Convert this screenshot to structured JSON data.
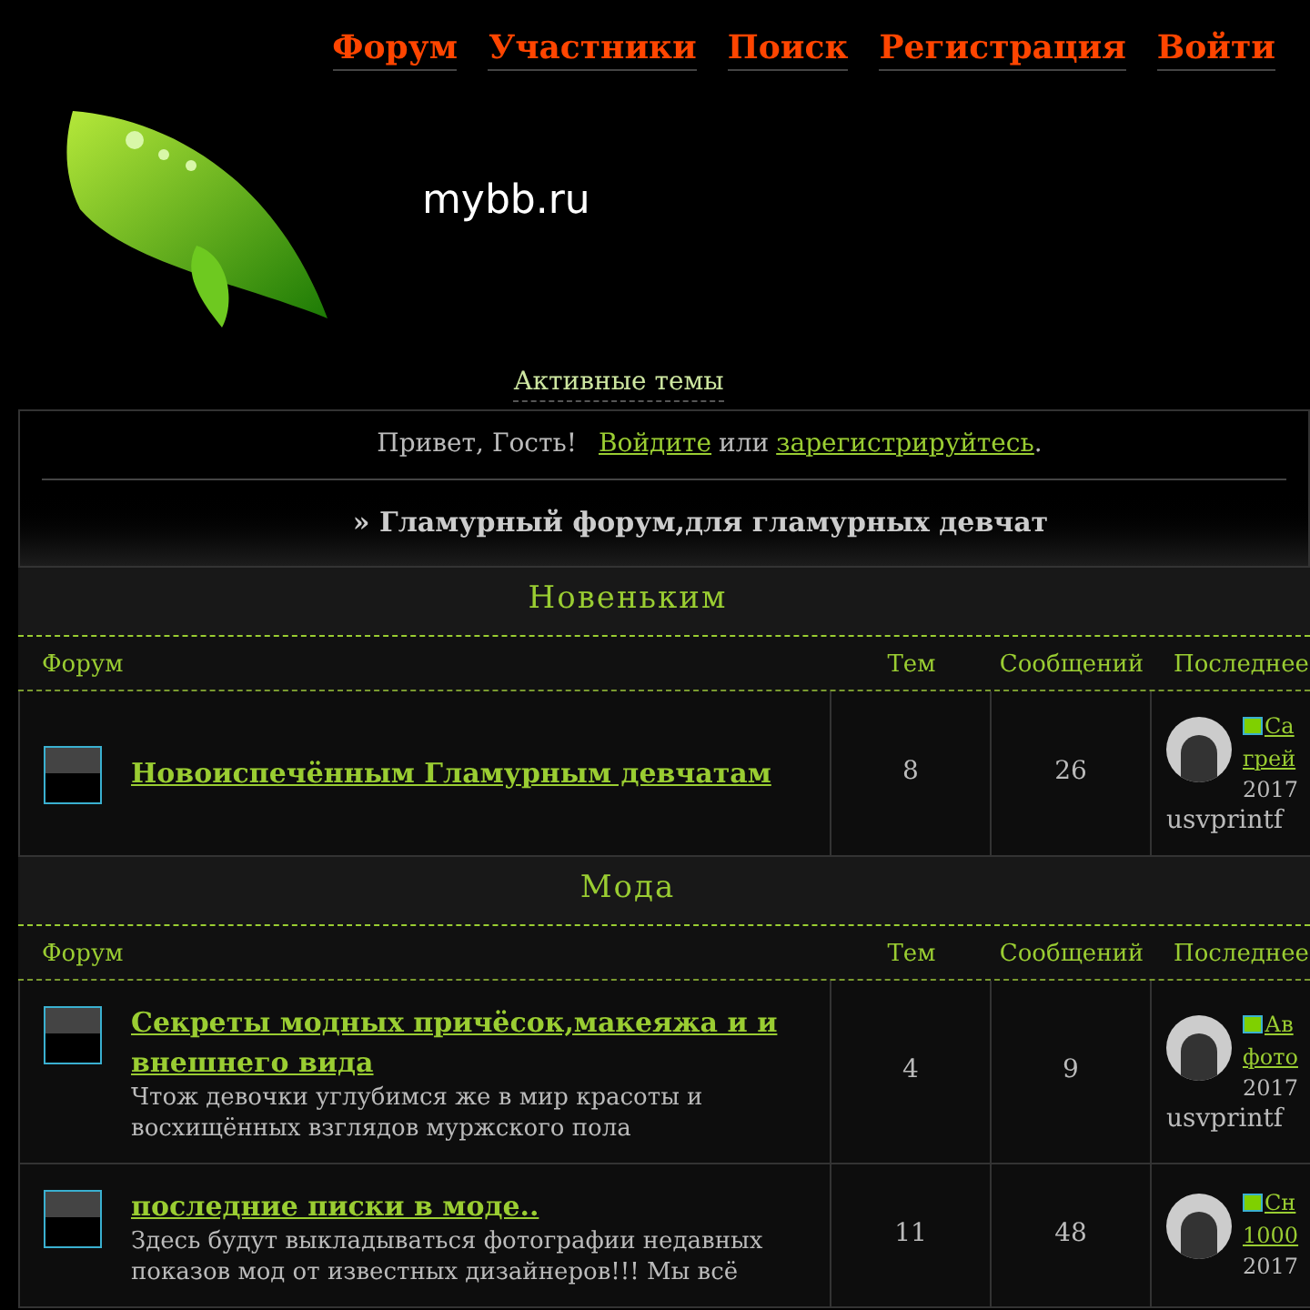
{
  "nav": [
    "Форум",
    "Участники",
    "Поиск",
    "Регистрация",
    "Войти"
  ],
  "logo": {
    "text": "mybb.ru"
  },
  "active_topics": "Активные темы",
  "welcome": {
    "greeting": "Привет, Гость!",
    "login": "Войдите",
    "or": "или",
    "register": "зарегистрируйтесь",
    "end": "."
  },
  "breadcrumb": "» Гламурный форум,для гламурных девчат",
  "sections": [
    {
      "title": "Новеньким",
      "columns": [
        "Форум",
        "Тем",
        "Сообщений",
        "Последнее"
      ],
      "rows": [
        {
          "name": "Новоиспечённым Гламурным девчатам",
          "description_lines": [],
          "topics": "8",
          "posts": "26",
          "last_post": {
            "link_lines": [
              "Са",
              "грей"
            ],
            "date": "2017",
            "author": "usvprintf"
          }
        }
      ]
    },
    {
      "title": "Мода",
      "columns": [
        "Форум",
        "Тем",
        "Сообщений",
        "Последнее"
      ],
      "rows": [
        {
          "name": "Секреты модных причёсок,макеяжа и и внешнего вида",
          "description_lines": [
            "Чтож девочки углубимся же в мир красоты и",
            "восхищённых взглядов муржского пола"
          ],
          "topics": "4",
          "posts": "9",
          "last_post": {
            "link_lines": [
              "Ав",
              "фото"
            ],
            "date": "2017",
            "author": "usvprintf"
          }
        },
        {
          "name": "последние писки в моде..",
          "description_lines": [
            "Здесь будут выкладываться фотографии недавных",
            "показов мод от известных дизайнеров!!! Мы всё"
          ],
          "topics": "11",
          "posts": "48",
          "last_post": {
            "link_lines": [
              "Сн",
              "1000"
            ],
            "date": "2017"
          }
        }
      ]
    }
  ]
}
